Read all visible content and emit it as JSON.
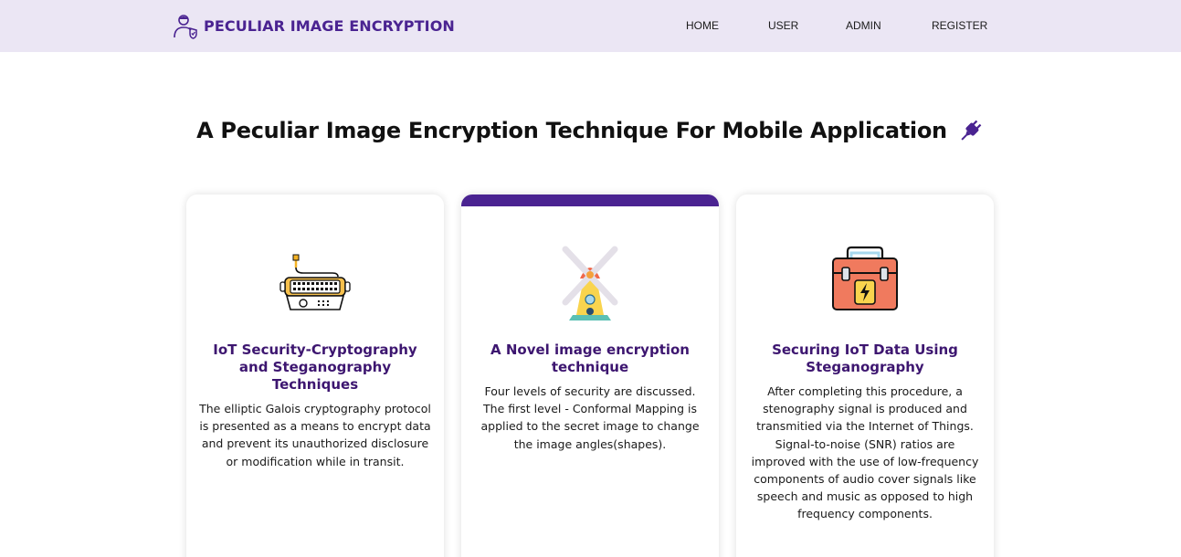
{
  "brand": {
    "name": "PECULIAR IMAGE ENCRYPTION",
    "logo_icon": "user-shield-icon",
    "color": "#4a2391"
  },
  "nav": {
    "home": "HOME",
    "user": "USER",
    "admin": "ADMIN",
    "register": "REGISTER"
  },
  "hero": {
    "title": "A Peculiar Image Encryption Technique For Mobile Application",
    "icon": "plug-icon"
  },
  "colors": {
    "navbar_bg": "#ebe6f4",
    "accent": "#4a2391",
    "card_title": "#3d1670"
  },
  "cards": [
    {
      "icon": "keyboard-icon",
      "title": "IoT Security-Cryptography and Steganography Techniques",
      "text": "The elliptic Galois cryptography protocol is presented as a means to encrypt data and prevent its unauthorized disclosure or modification while in transit."
    },
    {
      "icon": "windmill-icon",
      "title": "A Novel image encryption technique",
      "text": "Four levels of security are discussed. The first level - Conformal Mapping is applied to the secret image to change the image angles(shapes)."
    },
    {
      "icon": "toolbox-icon",
      "title": "Securing IoT Data Using Steganography",
      "text": "After completing this procedure, a stenography signal is produced and transmitied via the Internet of Things. Signal-to-noise (SNR) ratios are improved with the use of low-frequency components of audio cover signals like speech and music as opposed to high frequency components."
    }
  ]
}
